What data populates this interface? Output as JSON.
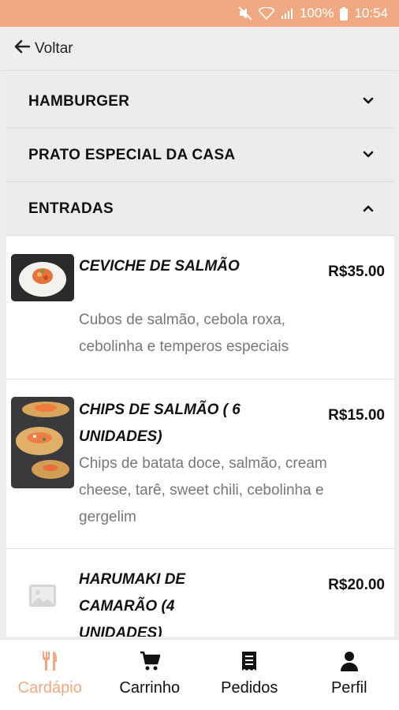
{
  "status": {
    "battery": "100%",
    "time": "10:54"
  },
  "header": {
    "back_label": "Voltar"
  },
  "categories": [
    {
      "label": "HAMBURGER",
      "expanded": false
    },
    {
      "label": "PRATO ESPECIAL DA CASA",
      "expanded": false
    },
    {
      "label": "ENTRADAS",
      "expanded": true
    }
  ],
  "items": [
    {
      "name": "CEVICHE DE SALMÃO",
      "price": "R$35.00",
      "description": "Cubos de salmão, cebola roxa, cebolinha e temperos especiais",
      "image": "dish-photo"
    },
    {
      "name": "CHIPS DE SALMÃO ( 6 UNIDADES)",
      "price": "R$15.00",
      "description": "Chips de batata doce, salmão, cream cheese, tarê, sweet chili, cebolinha e gergelim",
      "image": "dish-photo"
    },
    {
      "name": "HARUMAKI DE CAMARÃO (4 UNIDADES)",
      "price": "R$20.00",
      "description": "",
      "image": "image-placeholder-icon"
    }
  ],
  "tabs": [
    {
      "label": "Cardápio",
      "icon": "cutlery-icon",
      "active": true
    },
    {
      "label": "Carrinho",
      "icon": "cart-icon",
      "active": false
    },
    {
      "label": "Pedidos",
      "icon": "receipt-icon",
      "active": false
    },
    {
      "label": "Perfil",
      "icon": "user-icon",
      "active": false
    }
  ],
  "colors": {
    "accent": "#f0a983",
    "status_bar": "#f0a983",
    "description_text": "#777777"
  }
}
